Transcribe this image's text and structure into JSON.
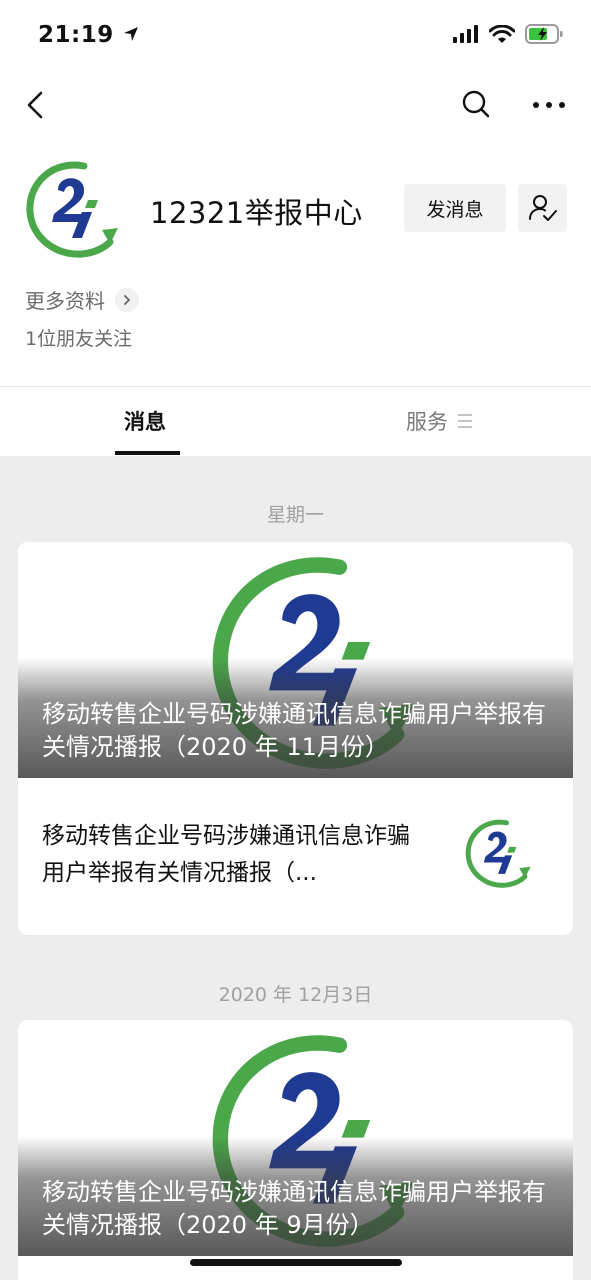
{
  "status": {
    "time": "21:19"
  },
  "account": {
    "name": "12321举报中心",
    "send_message": "发消息",
    "more_info": "更多资料",
    "followers": "1位朋友关注"
  },
  "tabs": {
    "messages": "消息",
    "services": "服务"
  },
  "feed": [
    {
      "date": "星期一",
      "cover_title": "移动转售企业号码涉嫌通讯信息诈骗用户举报有关情况播报（2020 年 11月份）",
      "sub_title": "移动转售企业号码涉嫌通讯信息诈骗用户举报有关情况播报（..."
    },
    {
      "date": "2020 年 12月3日",
      "cover_title": "移动转售企业号码涉嫌通讯信息诈骗用户举报有关情况播报（2020 年 9月份）"
    }
  ],
  "colors": {
    "logo_green": "#4aa84a",
    "logo_blue": "#1f3a93",
    "page_bg": "#ededed"
  }
}
